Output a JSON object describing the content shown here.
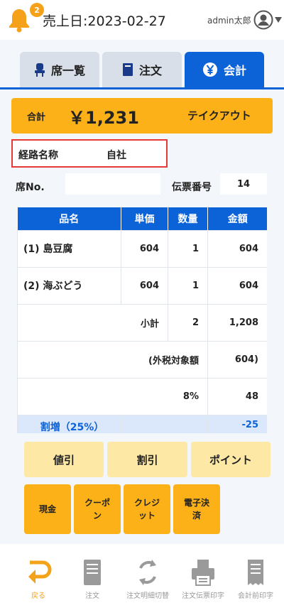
{
  "header": {
    "notification_count": "2",
    "sales_date": "売上日:2023-02-27",
    "username": "admin太郎"
  },
  "tabs": [
    {
      "label": "席一覧",
      "icon": "seat-icon",
      "active": false
    },
    {
      "label": "注文",
      "icon": "book-icon",
      "active": false
    },
    {
      "label": "会計",
      "icon": "yen-icon",
      "active": true
    }
  ],
  "total": {
    "label": "合計",
    "amount": "￥1,231",
    "type": "テイクアウト"
  },
  "route": {
    "label": "経路名称",
    "value": "自社"
  },
  "seat": {
    "label": "席No.",
    "value": ""
  },
  "slip": {
    "label": "伝票番号",
    "value": "14"
  },
  "table": {
    "headers": [
      "品名",
      "単価",
      "数量",
      "金額"
    ],
    "items": [
      {
        "name": "(1) 島豆腐",
        "price": "604",
        "qty": "1",
        "amount": "604"
      },
      {
        "name": "(2) 海ぶどう",
        "price": "604",
        "qty": "1",
        "amount": "604"
      }
    ],
    "subtotal": {
      "label": "小計",
      "qty": "2",
      "amount": "1,208"
    },
    "taxable": {
      "label": "(外税対象額",
      "amount": "604)"
    },
    "tax": {
      "rate": "8%",
      "amount": "48"
    },
    "surcharge": {
      "label": "割増（25%）",
      "amount": "-25"
    }
  },
  "actions": {
    "discount_value": "値引",
    "discount_rate": "割引",
    "points": "ポイント"
  },
  "payments": [
    "現金",
    "クーポン",
    "クレジット",
    "電子決済"
  ],
  "footer": [
    {
      "label": "戻る",
      "icon": "back-arrow-icon",
      "active": true
    },
    {
      "label": "注文",
      "icon": "order-sheet-icon",
      "active": false
    },
    {
      "label": "注文明細切替",
      "icon": "refresh-icon",
      "active": false
    },
    {
      "label": "注文伝票印字",
      "icon": "printer-icon",
      "active": false
    },
    {
      "label": "会計前印字",
      "icon": "receipt-icon",
      "active": false
    }
  ],
  "colors": {
    "accent": "#0c63d8",
    "orange": "#fbb117",
    "pale_yellow": "#fde8a6",
    "highlight_red": "#e53935"
  }
}
